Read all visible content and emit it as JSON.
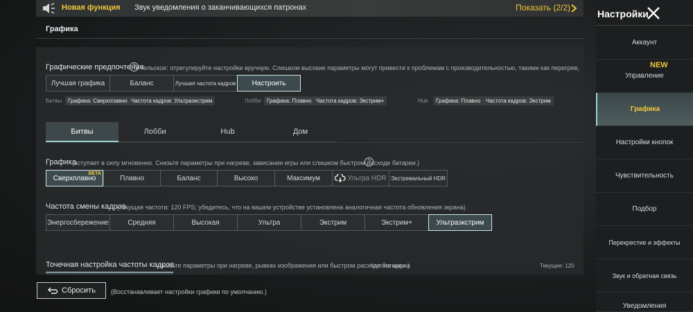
{
  "notification": {
    "title": "Новая функция",
    "text": "Звук уведомления о заканчивающихся патронах",
    "show_label": "Показать (2/2)"
  },
  "section_title": "Графика",
  "graphics_pref": {
    "label": "Графические предпочтения",
    "hint": "тельское: отрегулируйте настройки вручную. Слишком высокие параметры могут привести к проблемам с производительностью, такими как перегрев, быстрый разряд батареи",
    "options": [
      "Лучшая графика",
      "Баланс",
      "Лучшая частота кадров",
      "Настроить"
    ],
    "selected": "Настроить"
  },
  "summary": {
    "battles": {
      "label": "Битвы",
      "graphics": "Графика: Сверхплавно",
      "fps": "Частота кадров: Ультраэкстрим"
    },
    "lobby": {
      "label": "Лобби",
      "graphics": "Графика: Плавно",
      "fps": "Частота кадров: Экстрим+"
    },
    "hub": {
      "label": "Hub",
      "graphics": "Графика: Плавно",
      "fps": "Частота кадров: Экстрим"
    }
  },
  "tabs": [
    "Битвы",
    "Лобби",
    "Hub",
    "Дом"
  ],
  "graphics": {
    "label": "Графика",
    "hint": "(вступает в силу мгновенно. Снизьте параметры при нагреве, зависании игры или слишком быстром расходе батареи.)",
    "options": [
      "Сверхплавно",
      "Плавно",
      "Баланс",
      "Высоко",
      "Максимум",
      "Ультра HDR",
      "Экстремальный HDR"
    ],
    "selected": "Сверхплавно",
    "beta": "BETA"
  },
  "fps": {
    "label": "Частота смены кадров",
    "hint": "(текущая частота: 120 FPS; убедитесь, что на вашем устройстве установлена аналогичная частота обновления экрана)",
    "options": [
      "Энергосбережение",
      "Средняя",
      "Высокая",
      "Ультра",
      "Экстрим",
      "Экстрим+",
      "Ультраэкстрим"
    ],
    "selected": "Ультраэкстрим"
  },
  "fine_tune": {
    "label": "Точечная настройка частоты кадров",
    "hint": "(снизьте параметры при нагреве, рывках изображения или быстром расходе батареи.)",
    "fps_label": "Частота кадров",
    "current_label": "Текущее: 120"
  },
  "reset": {
    "label": "Сбросить",
    "hint": "(Восстанавливает настройки графики по умолчанию.)"
  },
  "sidebar": {
    "title": "Настройки",
    "new_badge": "NEW",
    "items": [
      "Аккаунт",
      "Управление",
      "Графика",
      "Настройки кнопок",
      "Чувствительность",
      "Подбор",
      "Перекрестие и эффекты",
      "Звук и обратная связь",
      "Уведомления"
    ],
    "selected": "Графика"
  },
  "colors": {
    "accent_yellow": "#f0c93a",
    "accent_teal": "#9bd4d6"
  }
}
